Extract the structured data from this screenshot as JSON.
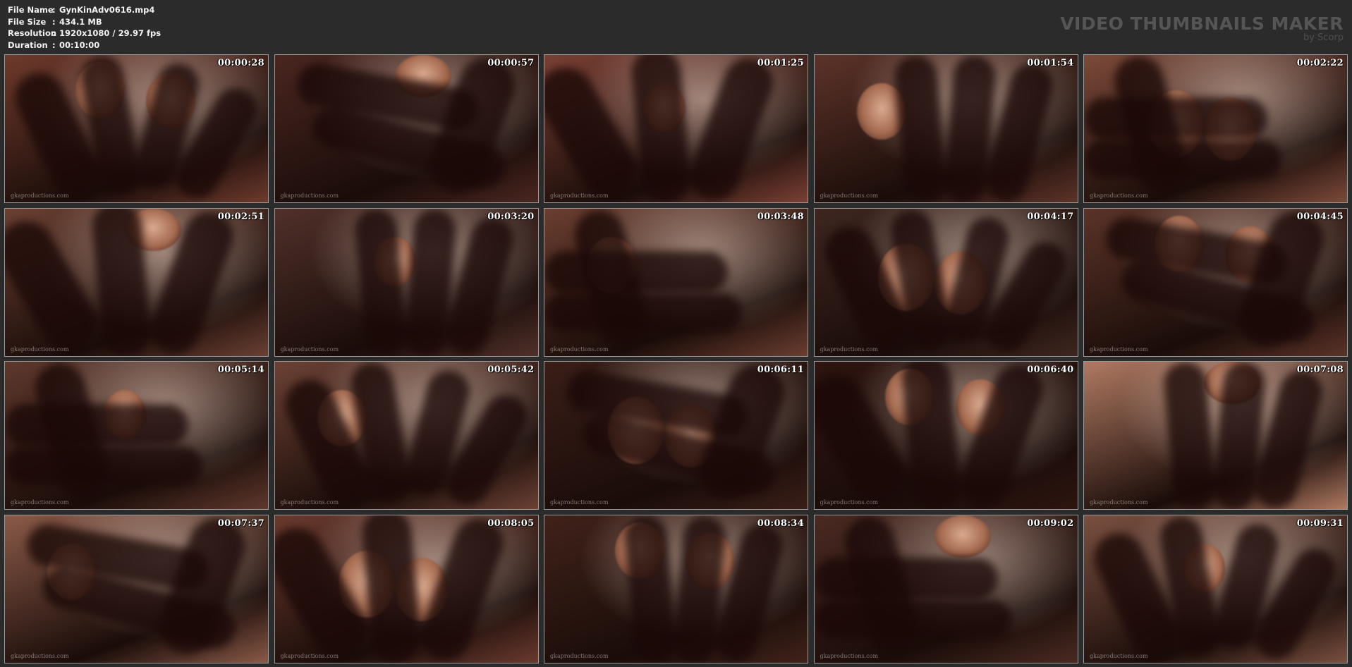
{
  "info": [
    {
      "label": "File Name",
      "value": "GynKinAdv0616.mp4"
    },
    {
      "label": "File Size",
      "value": "434.1 MB"
    },
    {
      "label": "Resolution",
      "value": "1920x1080 / 29.97 fps"
    },
    {
      "label": "Duration",
      "value": "00:10:00"
    }
  ],
  "info_separator": ":",
  "brand": {
    "title": "VIDEO THUMBNAILS MAKER",
    "by": "by Scorp"
  },
  "watermark": "gkaproductions.com",
  "thumbnails": [
    {
      "time": "00:00:28",
      "tone": "#6e3a2c"
    },
    {
      "time": "00:00:57",
      "tone": "#4a2620"
    },
    {
      "time": "00:01:25",
      "tone": "#7a4034"
    },
    {
      "time": "00:01:54",
      "tone": "#5c3329"
    },
    {
      "time": "00:02:22",
      "tone": "#7c4a3a"
    },
    {
      "time": "00:02:51",
      "tone": "#6a4032"
    },
    {
      "time": "00:03:20",
      "tone": "#50302a"
    },
    {
      "time": "00:03:48",
      "tone": "#6a3e30"
    },
    {
      "time": "00:04:17",
      "tone": "#3e2620"
    },
    {
      "time": "00:04:45",
      "tone": "#5a3328"
    },
    {
      "time": "00:05:14",
      "tone": "#5e382c"
    },
    {
      "time": "00:05:42",
      "tone": "#6b4134"
    },
    {
      "time": "00:06:11",
      "tone": "#3a1e18"
    },
    {
      "time": "00:06:40",
      "tone": "#2e1510"
    },
    {
      "time": "00:07:08",
      "tone": "#b07a62"
    },
    {
      "time": "00:07:37",
      "tone": "#8a5a48"
    },
    {
      "time": "00:08:05",
      "tone": "#6a3a2e"
    },
    {
      "time": "00:08:34",
      "tone": "#40221a"
    },
    {
      "time": "00:09:02",
      "tone": "#4a2a22"
    },
    {
      "time": "00:09:31",
      "tone": "#7a5040"
    }
  ],
  "colors": {
    "background": "#2b2b2b",
    "header_text": "#f2f2f2",
    "brand_text": "#555555",
    "thumb_border": "#9a9a9a"
  }
}
